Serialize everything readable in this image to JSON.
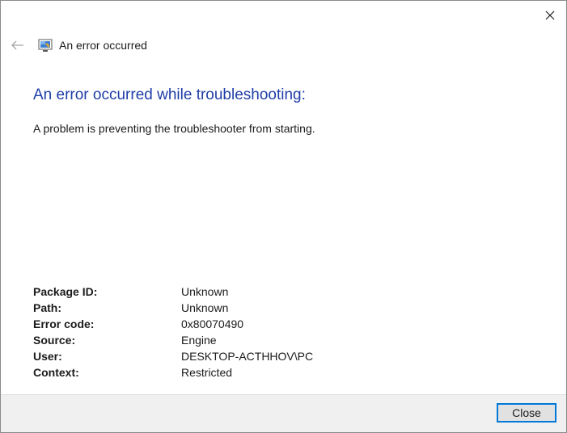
{
  "window": {
    "title": "An error occurred",
    "close_icon": "close-icon",
    "back_icon": "back-arrow-icon",
    "app_icon": "troubleshooter-icon"
  },
  "main": {
    "heading": "An error occurred while troubleshooting:",
    "description": "A problem is preventing the troubleshooter from starting."
  },
  "details": [
    {
      "label": "Package ID:",
      "value": "Unknown"
    },
    {
      "label": "Path:",
      "value": "Unknown"
    },
    {
      "label": "Error code:",
      "value": "0x80070490"
    },
    {
      "label": "Source:",
      "value": "Engine"
    },
    {
      "label": "User:",
      "value": "DESKTOP-ACTHHOV\\PC"
    },
    {
      "label": "Context:",
      "value": "Restricted"
    }
  ],
  "footer": {
    "close_label": "Close"
  },
  "colors": {
    "heading": "#1f3ea7",
    "footer_bg": "#f0f0f0",
    "button_border": "#0078d7"
  }
}
